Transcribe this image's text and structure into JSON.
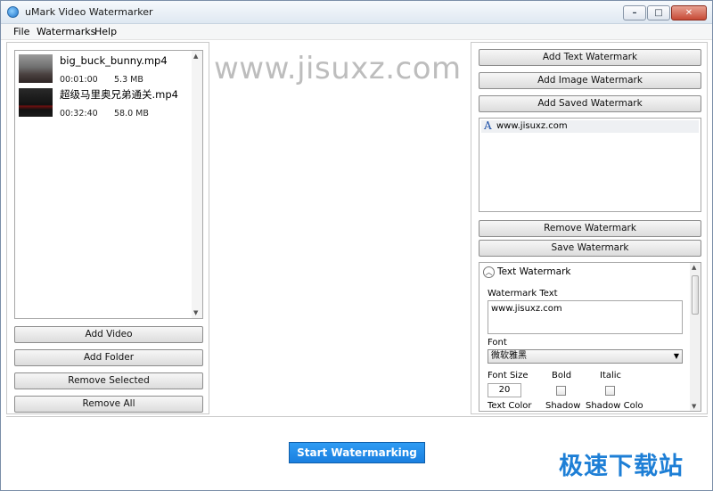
{
  "window": {
    "title": "uMark Video Watermarker"
  },
  "menu": [
    "File",
    "Watermarks",
    "Help"
  ],
  "videos": [
    {
      "name": "big_buck_bunny.mp4",
      "duration": "00:01:00",
      "size": "5.3 MB"
    },
    {
      "name": "超级马里奥兄弟通关.mp4",
      "duration": "00:32:40",
      "size": "58.0 MB"
    }
  ],
  "left_buttons": {
    "add_video": "Add Video",
    "add_folder": "Add Folder",
    "remove_selected": "Remove Selected",
    "remove_all": "Remove All"
  },
  "preview": {
    "watermark_text": "www.jisuxz.com"
  },
  "right_buttons": {
    "add_text": "Add Text Watermark",
    "add_image": "Add Image Watermark",
    "add_saved": "Add Saved Watermark",
    "remove": "Remove Watermark",
    "save": "Save Watermark"
  },
  "watermarks": [
    {
      "label": "www.jisuxz.com",
      "icon": "text-watermark-icon"
    }
  ],
  "properties": {
    "section_title": "Text Watermark",
    "watermark_text_label": "Watermark Text",
    "watermark_text_value": "www.jisuxz.com",
    "font_label": "Font",
    "font_value": "微软雅黑",
    "font_size_label": "Font Size",
    "font_size_value": "20",
    "bold_label": "Bold",
    "italic_label": "Italic",
    "text_color_label": "Text Color",
    "shadow_label": "Shadow",
    "shadow_color_label": "Shadow Colo"
  },
  "start_button": "Start Watermarking",
  "site_logo": "极速下载站"
}
